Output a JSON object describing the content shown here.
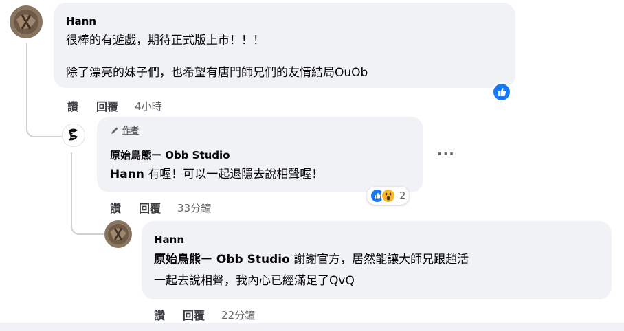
{
  "comments": [
    {
      "author": "Hann",
      "lines": [
        "很棒的有遊戲，期待正式版上市！！！",
        "除了漂亮的妹子們，也希望有唐門師兄們的友情結局OuOb"
      ],
      "like_label": "讚",
      "reply_label": "回覆",
      "time": "4小時"
    },
    {
      "badge": "作者",
      "author": "原始鳥熊ー Obb Studio",
      "mention": "Hann",
      "text": "有喔！可以一起退隱去說相聲喔！",
      "more": "···",
      "reaction_count": "2",
      "like_label": "讚",
      "reply_label": "回覆",
      "time": "33分鐘"
    },
    {
      "author": "Hann",
      "mention": "原始鳥熊ー Obb Studio",
      "text_line1": "謝謝官方，居然能讓大師兄跟趙活",
      "text_line2": "一起去說相聲，我內心已經滿足了QvQ",
      "like_label": "讚",
      "reply_label": "回覆",
      "time": "22分鐘"
    }
  ],
  "icons": {
    "like": "thumbs-up-icon",
    "wow": "wow-face-icon",
    "pencil": "pencil-icon",
    "more": "more-options-icon"
  },
  "colors": {
    "bubble": "#f0f2f5",
    "like_blue": "#1877f2",
    "wow_yellow": "#f7b928",
    "meta_gray": "#65676b"
  }
}
